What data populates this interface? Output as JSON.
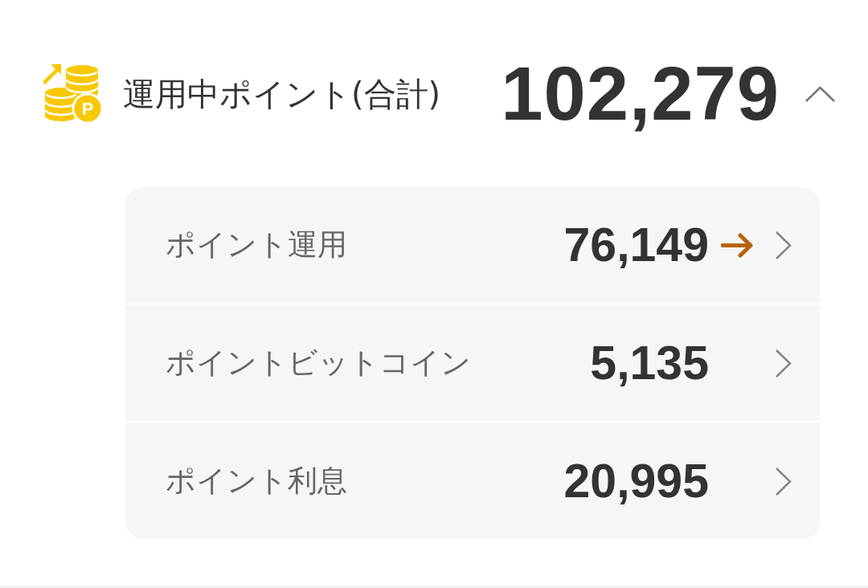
{
  "header": {
    "icon_badge": "P",
    "title": "運用中ポイント(合計)",
    "total": "102,279",
    "expanded": true
  },
  "items": [
    {
      "label": "ポイント運用",
      "value": "76,149",
      "arrow": true
    },
    {
      "label": "ポイントビットコイン",
      "value": "5,135",
      "arrow": false
    },
    {
      "label": "ポイント利息",
      "value": "20,995",
      "arrow": false
    }
  ]
}
